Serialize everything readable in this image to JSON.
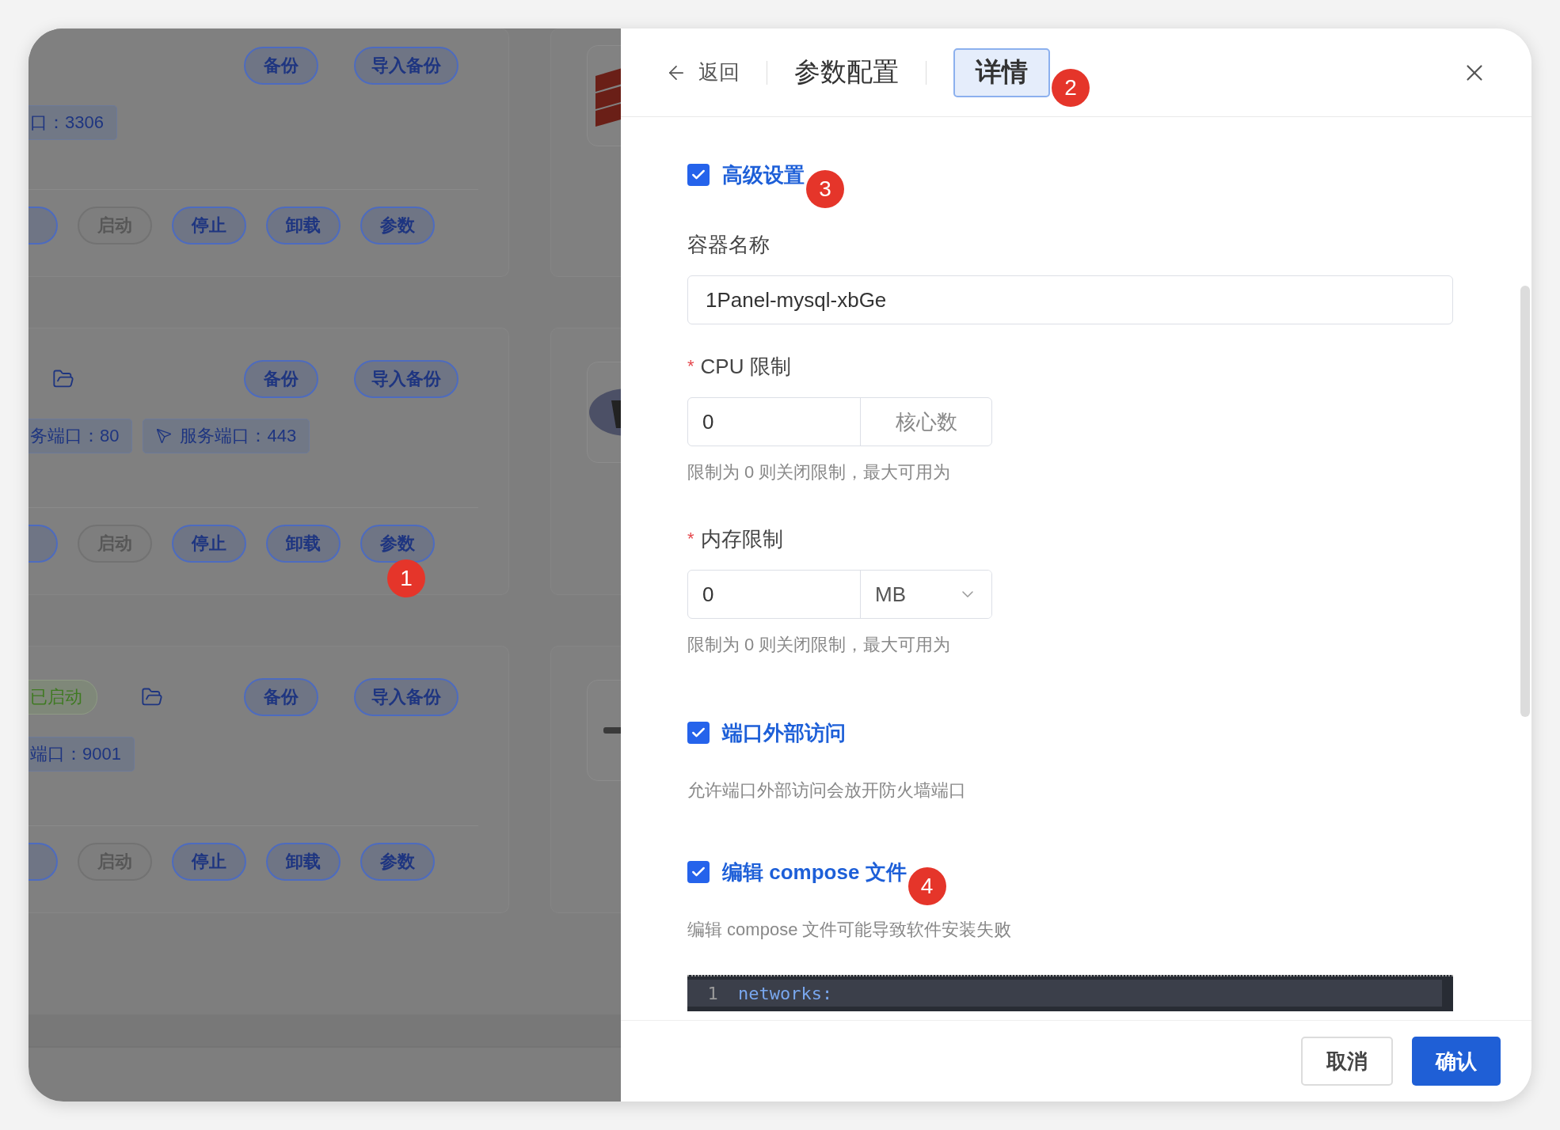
{
  "background": {
    "cards": [
      {
        "top_buttons": [
          "备份",
          "导入备份"
        ],
        "tags": [
          {
            "text": "口：3306",
            "kind": "plain"
          }
        ],
        "actions": [
          {
            "label": "启动",
            "disabled": true
          },
          {
            "label": "停止",
            "disabled": false
          },
          {
            "label": "卸载",
            "disabled": false
          },
          {
            "label": "参数",
            "disabled": false
          }
        ]
      },
      {
        "folder": true,
        "top_buttons": [
          "备份",
          "导入备份"
        ],
        "tags": [
          {
            "text": "务端口：80",
            "kind": "plain"
          },
          {
            "text": "服务端口：443",
            "kind": "linked"
          }
        ],
        "actions": [
          {
            "label": "启动",
            "disabled": true
          },
          {
            "label": "停止",
            "disabled": false
          },
          {
            "label": "卸载",
            "disabled": false
          },
          {
            "label": "参数",
            "disabled": false,
            "badge": "1"
          }
        ]
      },
      {
        "status": "已启动",
        "folder": true,
        "top_buttons": [
          "备份",
          "导入备份"
        ],
        "tags": [
          {
            "text": "端口：9001",
            "kind": "plain"
          }
        ],
        "actions": [
          {
            "label": "启动",
            "disabled": true
          },
          {
            "label": "停止",
            "disabled": false
          },
          {
            "label": "卸载",
            "disabled": false
          },
          {
            "label": "参数",
            "disabled": false
          }
        ]
      }
    ]
  },
  "drawer": {
    "back": "返回",
    "tabs": [
      {
        "label": "参数配置",
        "selected": false
      },
      {
        "label": "详情",
        "selected": true,
        "badge": "2"
      }
    ],
    "form": [
      {
        "kind": "checkbox",
        "label": "高级设置",
        "checked": true,
        "badge": "3"
      },
      {
        "kind": "text",
        "label": "容器名称",
        "value": "1Panel-mysql-xbGe"
      },
      {
        "kind": "unit",
        "marker": "*",
        "label": "CPU 限制",
        "value": "0",
        "unit": "核心数",
        "dropdown": false,
        "hint": "限制为 0 则关闭限制，最大可用为"
      },
      {
        "kind": "unit",
        "marker": "*",
        "label": "内存限制",
        "value": "0",
        "unit": "MB",
        "dropdown": true,
        "hint": "限制为 0 则关闭限制，最大可用为"
      },
      {
        "kind": "checkbox",
        "label": "端口外部访问",
        "checked": true,
        "hint": "允许端口外部访问会放开防火墙端口"
      },
      {
        "kind": "checkbox",
        "label": "编辑 compose 文件",
        "checked": true,
        "hint": "编辑 compose 文件可能导致软件安装失败",
        "badge": "4"
      },
      {
        "kind": "editor",
        "lines": [
          {
            "number": "1",
            "code": "networks:"
          }
        ]
      }
    ],
    "footer": [
      {
        "label": "取消",
        "kind": "default"
      },
      {
        "label": "确认",
        "kind": "primary"
      }
    ]
  }
}
